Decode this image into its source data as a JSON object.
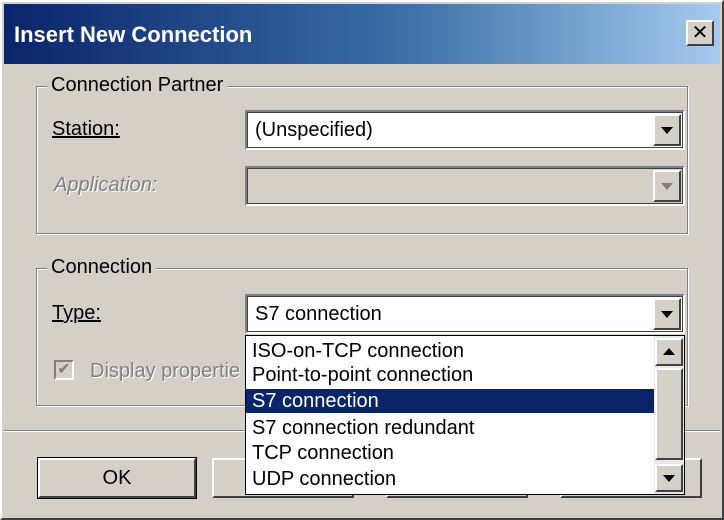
{
  "window": {
    "title": "Insert New Connection",
    "close_glyph": "✕"
  },
  "partner_group": {
    "legend": "Connection Partner",
    "station_label": "Station:",
    "station_value": "(Unspecified)",
    "application_label": "Application:",
    "application_value": ""
  },
  "connection_group": {
    "legend": "Connection",
    "type_label": "Type:",
    "type_value": "S7 connection",
    "display_properties_label": "Display propertie",
    "display_properties_checked": true,
    "display_properties_enabled": false
  },
  "type_dropdown": {
    "options": [
      "ISO-on-TCP connection",
      "Point-to-point connection",
      "S7 connection",
      "S7 connection redundant",
      "TCP connection",
      "UDP connection"
    ],
    "selected_index": 2
  },
  "buttons": {
    "ok_label": "OK"
  },
  "colors": {
    "dialog_face": "#d4d0c8",
    "title_gradient_start": "#0a246a",
    "title_gradient_end": "#a6caf0",
    "selection": "#0a246a"
  }
}
